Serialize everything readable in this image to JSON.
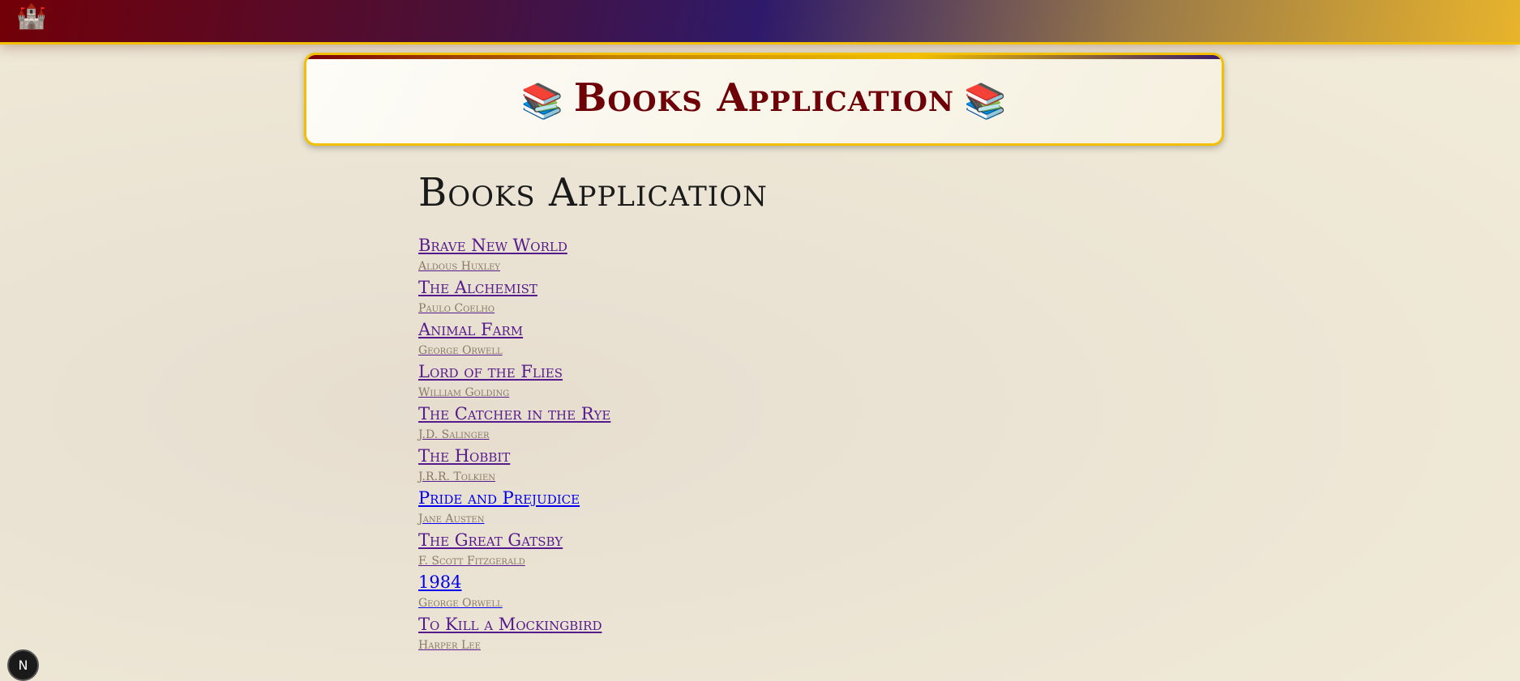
{
  "header": {
    "logo_icon": "🏰"
  },
  "banner": {
    "title": "Books Application",
    "icon": "📚"
  },
  "main": {
    "heading": "Books Application",
    "books": [
      {
        "title": "Brave New World",
        "author": "Aldous Huxley",
        "visited": true
      },
      {
        "title": "The Alchemist",
        "author": "Paulo Coelho",
        "visited": true
      },
      {
        "title": "Animal Farm",
        "author": "George Orwell",
        "visited": true
      },
      {
        "title": "Lord of the Flies",
        "author": "William Golding",
        "visited": true
      },
      {
        "title": "The Catcher in the Rye",
        "author": "J.D. Salinger",
        "visited": true
      },
      {
        "title": "The Hobbit",
        "author": "J.R.R. Tolkien",
        "visited": true
      },
      {
        "title": "Pride and Prejudice",
        "author": "Jane Austen",
        "visited": false
      },
      {
        "title": "The Great Gatsby",
        "author": "F. Scott Fitzgerald",
        "visited": true
      },
      {
        "title": "1984",
        "author": "George Orwell",
        "visited": false
      },
      {
        "title": "To Kill a Mockingbird",
        "author": "Harper Lee",
        "visited": true
      }
    ]
  },
  "devtools": {
    "label": "N"
  },
  "colors": {
    "visited": "#551a8b",
    "unvisited": "#0000ee",
    "banner_title": "#6e0008",
    "accent": "#f2c000"
  }
}
